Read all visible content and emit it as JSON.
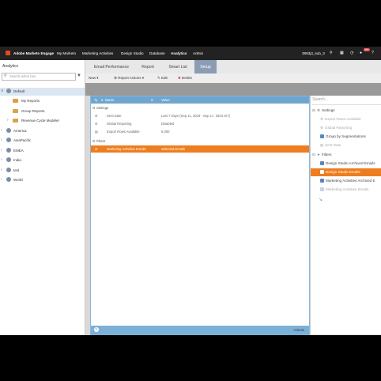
{
  "topbar": {
    "brand": "Adobe Marketo Engage",
    "nav": [
      "My Marketo",
      "Marketing Activities",
      "Design Studio",
      "Database",
      "Analytics",
      "Admin"
    ],
    "instance": "3893j3_sub_3",
    "badge": "99+"
  },
  "left_panel": {
    "title": "Analytics",
    "search_placeholder": "Search within tree",
    "tree": [
      {
        "label": "Default",
        "kind": "globe",
        "selected": true
      },
      {
        "label": "My Reports",
        "kind": "folder"
      },
      {
        "label": "Group Reports",
        "kind": "folder"
      },
      {
        "label": "Revenue Cycle Modeler",
        "kind": "folder"
      },
      {
        "label": "America",
        "kind": "globe"
      },
      {
        "label": "AsiaPacific",
        "kind": "globe"
      },
      {
        "label": "EMEA",
        "kind": "globe"
      },
      {
        "label": "India",
        "kind": "globe"
      },
      {
        "label": "test",
        "kind": "globe"
      },
      {
        "label": "World",
        "kind": "globe"
      }
    ]
  },
  "tabs": [
    "Email Performance",
    "Report",
    "Smart List",
    "Setup"
  ],
  "active_tab": "Setup",
  "toolbar": {
    "new": "New",
    "report_actions": "Report Actions",
    "edit": "Edit",
    "delete": "Delete"
  },
  "grid": {
    "headers": {
      "type": "Ty",
      "name": "Name",
      "value": "Value"
    },
    "settings_section": "Settings",
    "rows": [
      {
        "name": "Sent Date",
        "value": "Last 7 Days (Sep 11, 2023 - Sep 17, 2023 IST)"
      },
      {
        "name": "Global Reporting",
        "value": "Disabled"
      },
      {
        "name": "Export Rows Available",
        "value": "5,000"
      }
    ],
    "filters_section": "Filters",
    "filter_row": {
      "name": "Marketing Activities Emails",
      "value": "Selected Emails"
    },
    "footer_count": "4 items"
  },
  "right_panel": {
    "search_placeholder": "Search...",
    "settings_label": "Settings",
    "settings_items": [
      {
        "label": "Export Rows Available",
        "disabled": true
      },
      {
        "label": "Global Reporting",
        "disabled": true
      },
      {
        "label": "Group by Segmentations",
        "disabled": false
      },
      {
        "label": "Sent Date",
        "disabled": true
      }
    ],
    "filters_label": "Filters",
    "filter_items": [
      {
        "label": "Design Studio Archived Emails",
        "highlight": false,
        "disabled": false
      },
      {
        "label": "Design Studio Emails",
        "highlight": true,
        "disabled": false
      },
      {
        "label": "Marketing Activities Archived E",
        "highlight": false,
        "disabled": false
      },
      {
        "label": "Marketing Activities Emails",
        "highlight": false,
        "disabled": true
      }
    ]
  },
  "colors": {
    "accent_orange": "#ee7d1f",
    "grid_header_blue": "#6fa6cf",
    "active_tab": "#8a9db5"
  }
}
